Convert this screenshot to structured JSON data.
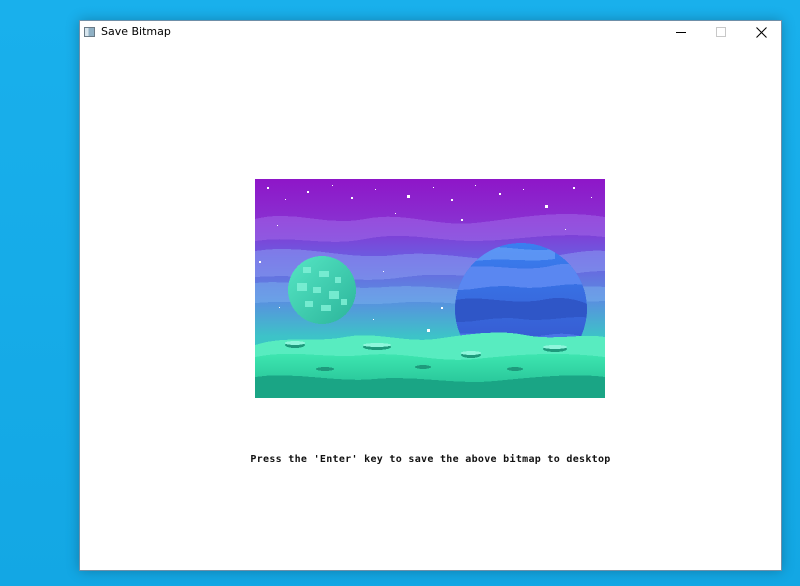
{
  "window": {
    "title": "Save Bitmap",
    "icon": "app-window-icon",
    "controls": {
      "minimize": "minimize-icon",
      "maximize": "maximize-icon",
      "close": "close-icon"
    }
  },
  "content": {
    "image": {
      "subject": "pixel-art space landscape",
      "colors": {
        "sky_top": "#8e16c8",
        "sky_mid": "#6a5ae0",
        "horizon": "#3dc3c8",
        "ground": "#2ad8a0",
        "big_planet": "#3f74e6",
        "small_planet": "#3fd2b4"
      }
    },
    "caption": "Press the 'Enter' key to save the above bitmap to desktop"
  }
}
